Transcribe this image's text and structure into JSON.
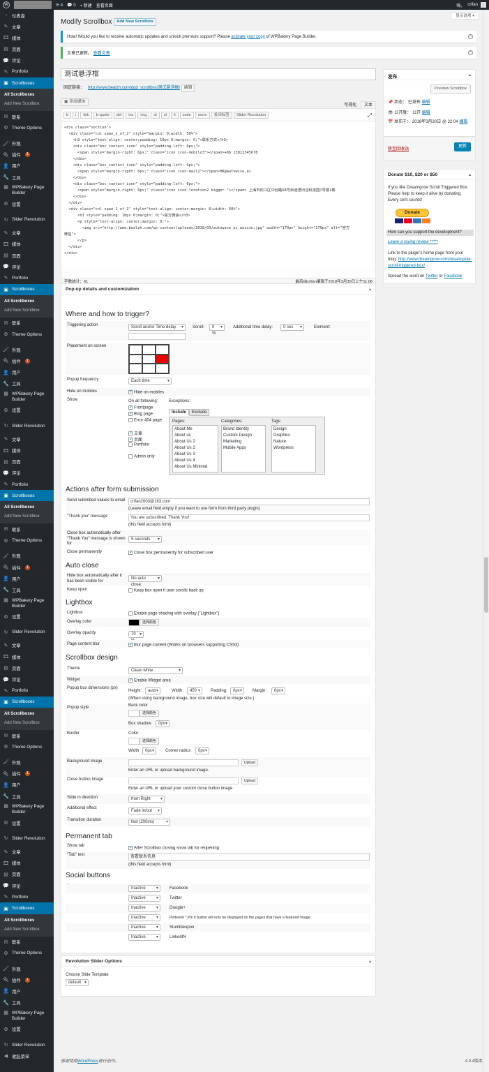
{
  "adminbar": {
    "updates": "4",
    "comments": "0",
    "new": "新建",
    "view": "查看页面",
    "greeting": "嗨，",
    "user": "crifan"
  },
  "menu": {
    "dashboard": "仪表盘",
    "posts": "文章",
    "media": "媒体",
    "pages": "页面",
    "comments": "评论",
    "portfolio": "Portfolio",
    "scrollboxes": "Scrollboxes",
    "all_scrollboxes": "All Scrollboxes",
    "add_new": "Add New Scrollbox",
    "contact": "联系",
    "theme_options": "Theme Options",
    "appearance": "外观",
    "plugins": "插件",
    "plugins_badge": "1",
    "users": "用户",
    "tools": "工具",
    "wpbakery": "WPBakery Page Builder",
    "settings": "设置",
    "slider": "Slider Revolution",
    "collapse": "收起菜单"
  },
  "screen_options": "显示选项",
  "page_title": "Modify Scrollbox",
  "add_new_button": "Add New Scrollbox",
  "notice1": {
    "text": "Hola! Would you like to receive automatic updates and unlock premium support? Please",
    "link": "activate your copy",
    "rest": "of WPBakery Page Builder."
  },
  "notice2": {
    "text": "文章已更新。",
    "link": "查看文章"
  },
  "post_title": "测试悬浮框",
  "permalink": {
    "label": "固定链接：",
    "url": "http://www.bealzh.com/dgd_scrollbox/测试悬浮框/",
    "edit": "编辑"
  },
  "editor": {
    "add_media": "添加媒体",
    "visual": "可视化",
    "text": "文本",
    "quicktags": [
      "b",
      "i",
      "link",
      "b-quote",
      "del",
      "ins",
      "img",
      "ul",
      "ol",
      "li",
      "code",
      "more",
      "关闭标签",
      "Slider Revolution"
    ],
    "code_lines": [
      "<div class=\"section\">",
      "  <div class=\"col span_1_of_2\" style=\"margin: 0;width: 50%\">",
      "    <h3 style=\"text-align: center;padding: 10px 0;margin: 0;\">联系方式</h3>",
      "    <div class=\"boc_contact_icon\" style=\"padding-left: 6px;\">",
      "      <span style=\"margin-right: 6px;\" class=\"icon icon-mobile3\"></span>+86 13812345678",
      "    </div>",
      "    <div class=\"boc_contact_icon\" style=\"padding-left: 6px;\">",
      "      <span style=\"margin-right: 6px;\" class=\"icon icon-mail2\"></span>HR@autowise.ai",
      "    </div>",
      "    <div class=\"boc_contact_icon\" style=\"padding-left: 6px;\">",
      "      <span style=\"margin-right: 6px;\" class=\"icon icon-location2 bigger \"></span> 上海市松江区中创路68号启迪漕河泾科技园1号楼1楼",
      "    </div>",
      "  </div>",
      "  <div class=\"col span_1_of_2\" style=\"text-align: center;margin: 0;width: 50%\">",
      "      <h3 style=\"padding: 10px 0;margin: 0;\">官方微信</h3>",
      "      <p style=\"text-align: center;margin: 0;\">",
      "        <img src=\"http://www.bealzh.com/wp-content/uploads/2018/03/autowise_ai_weixin.jpg\" width=\"170px\" height=\"170px\" alt=\"官方",
      "微信\">",
      "      </p>",
      "  </div>",
      "</div>"
    ],
    "word_count": "字数统计：61",
    "last_edit": "最后由crifan编辑于2018年3月30日上午11:06"
  },
  "popup": {
    "title": "Pop-up details and customization",
    "trigger_heading": "Where and how to trigger?",
    "triggering_label": "Triggering action",
    "triggering_value": "Scroll and/or Time delay",
    "scroll_label": "Scroll:",
    "scroll_value": "0 %",
    "delay_label": "Additional time delay:",
    "delay_value": "0 sec",
    "element_label": "Element:",
    "placement_label": "Placement on screen",
    "frequency_label": "Popup frequency",
    "frequency_value": "Each time",
    "hide_mobiles_label": "Hide on mobiles",
    "hide_mobiles_check": "Hide on mobiles",
    "show_label": "Show",
    "on_all": "On all following:",
    "exceptions": "Exceptions:",
    "show_items": [
      "Frontpage",
      "Blog page",
      "Error 404 page"
    ],
    "post_types": [
      "文章",
      "页面",
      "Portfolio"
    ],
    "admin_only": "Admin only",
    "tab_include": "Include",
    "tab_exclude": "Exclude",
    "pages_label": "Pages:",
    "categories_label": "Categories:",
    "tags_label": "Tags:",
    "pages": [
      "About Me",
      "About us",
      "About Us 2",
      "About Us 2",
      "About Us 3",
      "About Us 4",
      "About Us Minimal"
    ],
    "categories": [
      "Brand Identity",
      "Custom Design",
      "Marketing",
      "Mobile Apps"
    ],
    "tags": [
      "Design",
      "Graphics",
      "Nature",
      "Wordpress"
    ],
    "actions_heading": "Actions after form submission",
    "send_label": "Send submitted values to email",
    "send_value": "crifan2003@163.com",
    "send_note": "(Leave email field empty if you want to use form from third party plugin)",
    "thank_label": "\"Thank you\" message",
    "thank_value": "You are subscribed. Thank You!",
    "thank_note": "(this field accepts html)",
    "close_auto_label": "Close box automatically after \"Thank You\" message is shown for",
    "close_auto_value": "5 seconds",
    "close_perm_label": "Close permanently",
    "close_perm_check": "Close box permanently for subscribed user",
    "autoclose_heading": "Auto close",
    "hide_after_label": "Hide box automatically after it has been visible for",
    "hide_after_value": "No auto close",
    "keep_open_label": "Keep open",
    "keep_open_check": "Keep box open if user scrolls back up",
    "lightbox_heading": "Lightbox",
    "lightbox_label": "Lightbox",
    "lightbox_check": "Enable page shading with overlay (\"Lightbox\")",
    "overlay_color_label": "Overlay color",
    "choose_color": "选择颜色",
    "overlay_opacity_label": "Overlay opacity",
    "overlay_opacity_value": "70 %",
    "blur_label": "Page content blur",
    "blur_check": "blur page content (Works on browsers supporting CSS3)",
    "design_heading": "Scrollbox design",
    "theme_label": "Theme",
    "theme_value": "Clean white",
    "widget_label": "Widget",
    "widget_check": "Enable Widget area",
    "dims_label": "Popup box dimensions (px)",
    "height_label": "Height:",
    "height_value": "auto",
    "width_label": "Width:",
    "width_value": "450",
    "padding_label": "Padding:",
    "padding_value": "0px",
    "margin_label": "Margin:",
    "margin_value": "0px",
    "dims_note": "(When using background image, box size will default to image size.)",
    "style_label": "Popup style",
    "back_color": "Back color",
    "box_shadow": "Box shadow",
    "box_shadow_value": "0px",
    "border_label": "Border",
    "color_label": "Color",
    "width_lbl": "Width",
    "border_width_value": "0px",
    "corner_label": "Corner radius",
    "corner_value": "0px",
    "bg_image_label": "Background Image",
    "upload": "Upload",
    "bg_note": "Enter an URL or upload background image.",
    "close_img_label": "Close button Image",
    "close_note": "Enter an URL or upload your custom close button image.",
    "slide_label": "Slide in direction",
    "slide_value": "from Right",
    "effect_label": "Additional effect",
    "effect_value": "Fade in/out",
    "duration_label": "Transition duration",
    "duration_value": "fast (200ms)",
    "tab_heading": "Permanent tab",
    "show_tab_label": "Show tab",
    "show_tab_check": "After Scrollbox closing show tab for reopening",
    "tab_text_label": "\"Tab\" text",
    "tab_text_value": "查看联系信息",
    "tab_text_note": "(this field accepts html)",
    "social_heading": "Social buttons",
    "social_label": "Social buttons",
    "social": [
      {
        "state": "Inactive",
        "name": "Facebook"
      },
      {
        "state": "Inactive",
        "name": "Twitter"
      },
      {
        "state": "Inactive",
        "name": "Google+"
      },
      {
        "state": "Inactive",
        "name": "Pinterest * Pin it button will only be displayed on the pages that have a featured image."
      },
      {
        "state": "Inactive",
        "name": "Stumbleupon"
      },
      {
        "state": "Inactive",
        "name": "LinkedIN"
      }
    ]
  },
  "revslider": {
    "title": "Revolution Slider Options",
    "choose_label": "Choose Slide Template",
    "value": "default"
  },
  "publish": {
    "title": "发布",
    "preview": "Preview Scrollbox",
    "status_label": "状态：",
    "status": "已发布",
    "edit": "编辑",
    "visibility_label": "公开度：",
    "visibility": "公开",
    "published_label": "发布于：",
    "published": "2018年3月30日 @ 22:04",
    "trash": "移至回收站",
    "update": "更新"
  },
  "donate": {
    "title": "Donate $10, $20 or $50",
    "text": "If you like Dreamgrow Scroll Triggered Box. Please help to keep it alive by donating. Every cent counts!",
    "button": "Donate",
    "support_heading": "How can you support the development?",
    "review_link": "Leave a raving review *****",
    "link_text": "Link to the plugin's home page from your blog:",
    "link_url": "http://www.dreamgrow.com/dreamgrow-scroll-triggered-box/",
    "spread": "Spread the word on",
    "twitter": "Twitter",
    "or": "or",
    "facebook": "Facebook"
  },
  "footer": {
    "thanks": "感谢使用",
    "wp": "WordPress",
    "thanks2": "进行创作。",
    "version": "4.9.4版本"
  }
}
